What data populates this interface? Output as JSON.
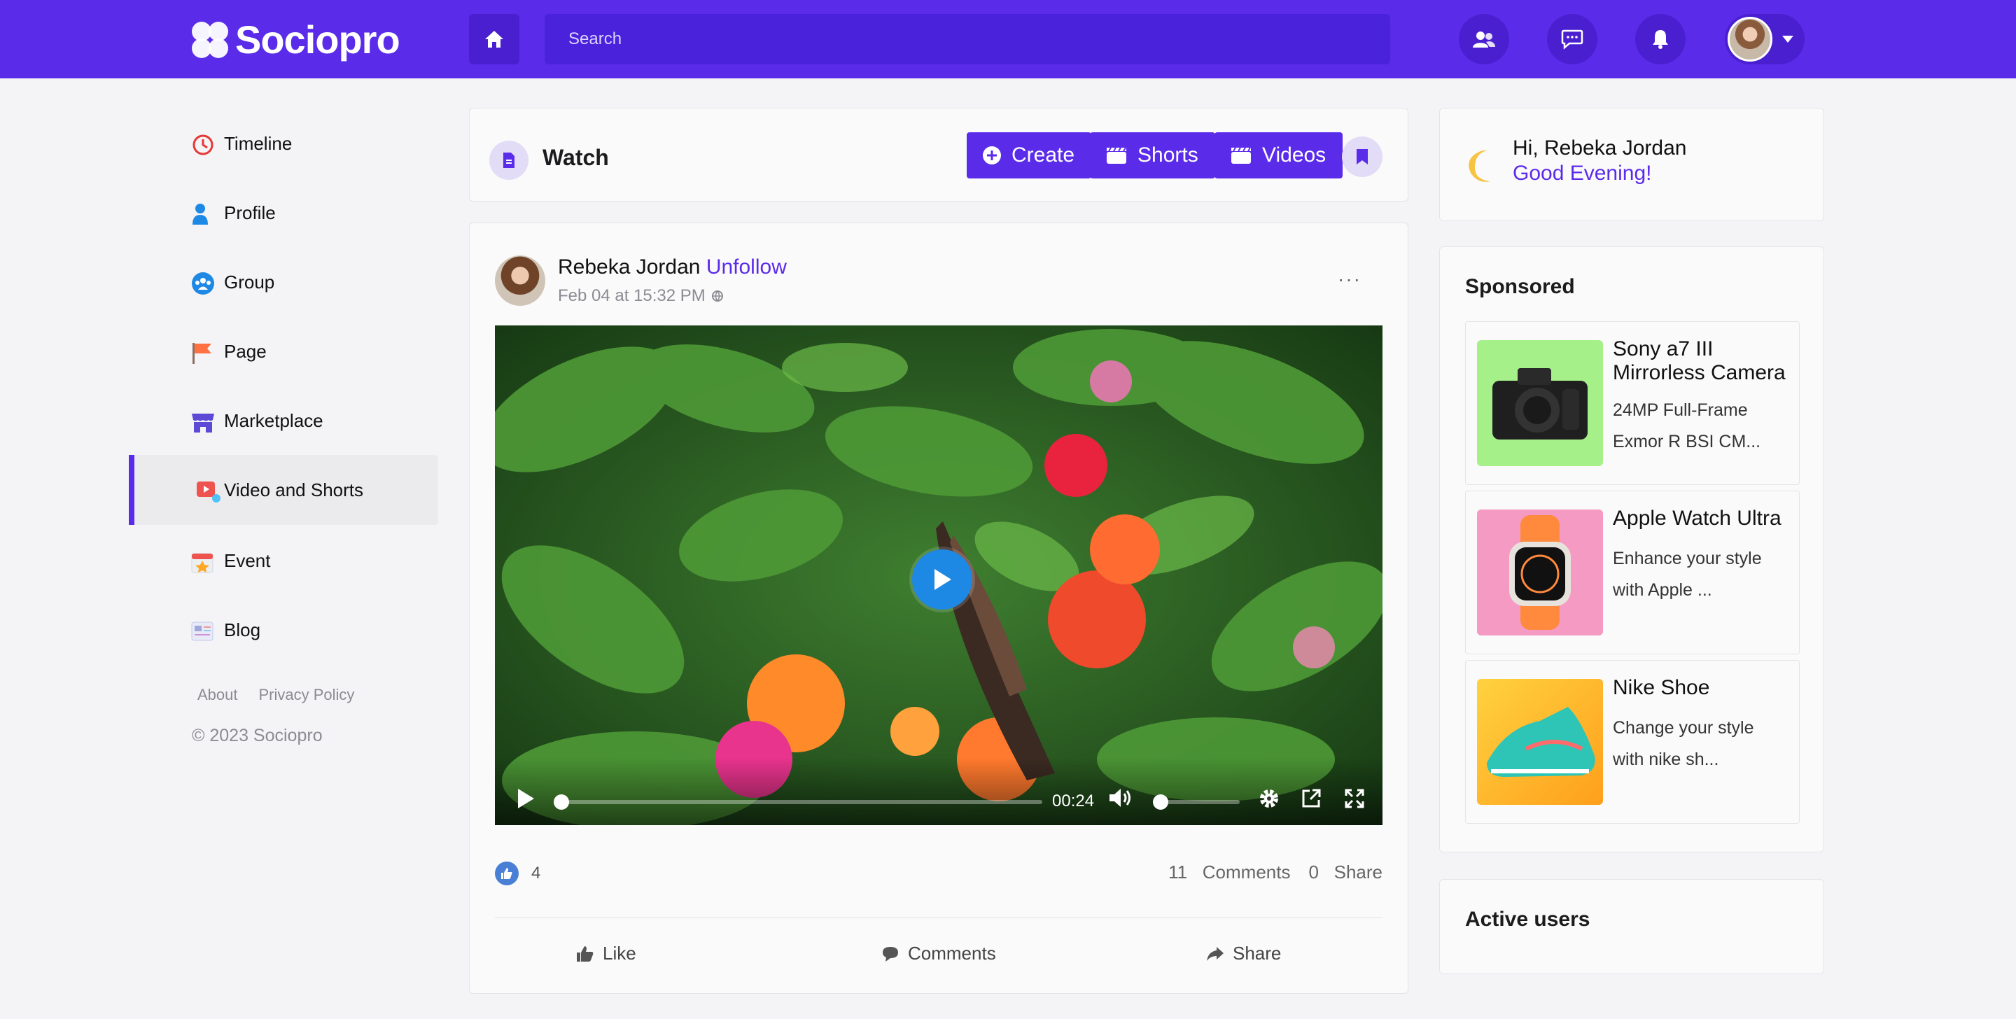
{
  "app": {
    "name": "Sociopro"
  },
  "header": {
    "search_placeholder": "Search",
    "icons": [
      "home-icon",
      "friends-icon",
      "chat-icon",
      "bell-icon",
      "avatar"
    ]
  },
  "sidebar": {
    "items": [
      {
        "label": "Timeline",
        "icon": "clock-icon"
      },
      {
        "label": "Profile",
        "icon": "user-icon"
      },
      {
        "label": "Group",
        "icon": "group-icon"
      },
      {
        "label": "Page",
        "icon": "flag-icon"
      },
      {
        "label": "Marketplace",
        "icon": "store-icon"
      },
      {
        "label": "Video and Shorts",
        "icon": "video-icon",
        "active": true
      },
      {
        "label": "Event",
        "icon": "calendar-icon"
      },
      {
        "label": "Blog",
        "icon": "blog-icon"
      }
    ],
    "footer": {
      "about": "About",
      "privacy": "Privacy Policy",
      "copyright": "© 2023 Sociopro"
    }
  },
  "watch": {
    "title": "Watch",
    "buttons": {
      "create": "Create",
      "shorts": "Shorts",
      "videos": "Videos"
    }
  },
  "post": {
    "author": "Rebeka Jordan",
    "follow_label": "Unfollow",
    "timestamp": "Feb 04 at 15:32 PM",
    "more": "···",
    "video": {
      "time": "00:24",
      "progress": 0.0
    },
    "likes": "4",
    "comments_count": "11",
    "comments_label": "Comments",
    "shares_count": "0",
    "share_label": "Share",
    "actions": {
      "like": "Like",
      "comments": "Comments",
      "share": "Share"
    }
  },
  "greeting": {
    "name": "Hi, Rebeka Jordan",
    "message": "Good Evening!"
  },
  "sponsored": {
    "title": "Sponsored",
    "ads": [
      {
        "title": "Sony a7 III Mirrorless Camera",
        "desc": "24MP Full-Frame Exmor R BSI CM..."
      },
      {
        "title": "Apple Watch Ultra",
        "desc": "Enhance your style with Apple ..."
      },
      {
        "title": "Nike Shoe",
        "desc": "Change your style with nike sh..."
      }
    ]
  },
  "active_users": {
    "title": "Active users"
  },
  "colors": {
    "brand": "#5b2bea",
    "brand_dark": "#4a1fd0",
    "like": "#4a7fd6",
    "play": "#1e88e5"
  }
}
